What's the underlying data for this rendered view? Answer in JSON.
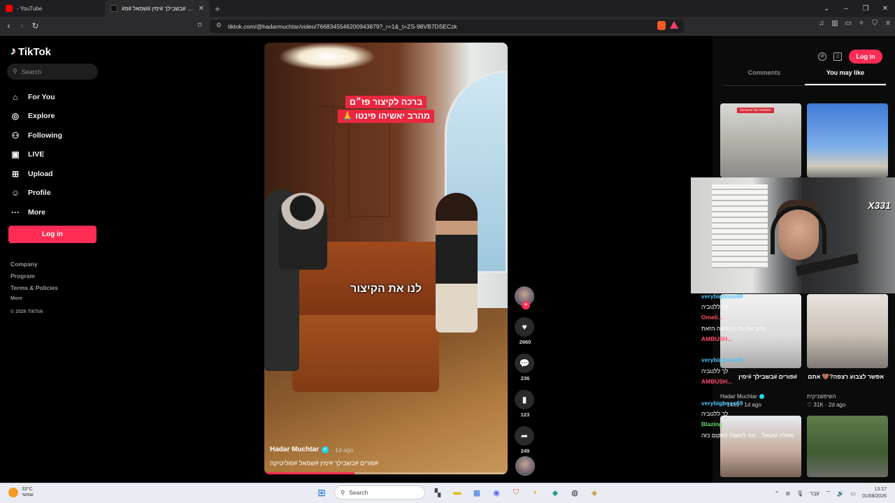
{
  "browser": {
    "tabs": [
      {
        "title": "- YouTube",
        "active": false,
        "favicon_color": "#ff0000"
      },
      {
        "title": "#פורים #בשבילך #ימין #שמאל #פ",
        "active": true,
        "favicon_color": "#111111"
      }
    ],
    "url": "tiktok.com/@hadarmuchtar/video/7668345546200943879?_r=1&_t=ZS-98VB7DSECzk"
  },
  "tiktok": {
    "logo": "TikTok",
    "search_placeholder": "Search",
    "nav": [
      {
        "label": "For You",
        "icon": "home-icon",
        "glyph": "⌂"
      },
      {
        "label": "Explore",
        "icon": "compass-icon",
        "glyph": "◎"
      },
      {
        "label": "Following",
        "icon": "following-icon",
        "glyph": "⚇"
      },
      {
        "label": "LIVE",
        "icon": "live-icon",
        "glyph": "▣"
      },
      {
        "label": "Upload",
        "icon": "upload-icon",
        "glyph": "⊞"
      },
      {
        "label": "Profile",
        "icon": "profile-icon",
        "glyph": "☺"
      },
      {
        "label": "More",
        "icon": "more-icon",
        "glyph": "···"
      }
    ],
    "login": "Log in",
    "footer": {
      "company": "Company",
      "program": "Program",
      "terms": "Terms & Policies",
      "more": "More",
      "copyright": "© 2026 TikTok"
    },
    "video": {
      "caption_line1": "ברכה לקיצור פז״ם",
      "caption_line2": "מהרב יאשיהו פינטו 🙏",
      "caption_mid": "לנו את הקיצור",
      "author": "Hadar Muchtar",
      "date": "· 1d ago",
      "hashtags": "#פורים #בשבילך #ימין #שמאל #פוליטיקה",
      "progress": 0.37
    },
    "actions": {
      "likes": "2660",
      "comments": "236",
      "saves": "123",
      "shares": "249"
    },
    "right": {
      "login": "Log in",
      "tab_comments": "Comments",
      "tab_you_may_like": "You may like",
      "cards": [
        {
          "tag": "האמהות של אינטראל",
          "title": "",
          "author": "",
          "stats": ""
        },
        {
          "tag": "",
          "title": "",
          "author": "",
          "stats": ""
        },
        {
          "tag": "",
          "title": "#פורים #בשבילך #ימין",
          "author": "Hadar Muchtar",
          "stats": "♡ 1459 · 1d ago"
        },
        {
          "tag": "",
          "title": "אפשר לצבוע רצפה?🤎 אתם",
          "author": "השיפוצניקית",
          "stats": "♡ 31K · 2d ago"
        }
      ]
    }
  },
  "stream": {
    "cam_badge": "X331",
    "chat": [
      {
        "user": "verybigboss69",
        "color": "#4fc3f7",
        "text": ""
      },
      {
        "user": "",
        "color": "#4fc3f7",
        "text": "לך ללטביה"
      },
      {
        "user": "Omeli...",
        "color": "#ff5252",
        "text": ""
      },
      {
        "user": "",
        "color": "#ff5252",
        "text": "עזוב את כל הטמונה הזאת"
      },
      {
        "user": "AMBUSH...",
        "color": "#ff4d6d",
        "text": ""
      },
      {
        "user": "",
        "color": "#ff4d6d",
        "text": ""
      },
      {
        "user": "verybigboss69",
        "color": "#4fc3f7",
        "text": ""
      },
      {
        "user": "",
        "color": "#4fc3f7",
        "text": "לך ללטביה"
      },
      {
        "user": "AMBUSH...",
        "color": "#ff4d6d",
        "text": ""
      },
      {
        "user": "",
        "color": "#ff4d6d",
        "text": ""
      },
      {
        "user": "verybigboss69",
        "color": "#4fc3f7",
        "text": ""
      },
      {
        "user": "",
        "color": "#4fc3f7",
        "text": "לך ללטביה"
      },
      {
        "user": "Blazing",
        "color": "#6bd96b",
        "text": ""
      },
      {
        "user": "",
        "color": "#6bd96b",
        "text": "שאלה ששאל... מה לעשות למקום כזה"
      }
    ]
  },
  "taskbar": {
    "weather_temp": "33°C",
    "weather_desc": "שמשי",
    "search": "Search",
    "lang": "עבר",
    "time": "13:17",
    "date": "01/08/2026"
  },
  "colors": {
    "accent": "#fe2c55",
    "verified": "#20d5ec",
    "background": "#000000"
  }
}
